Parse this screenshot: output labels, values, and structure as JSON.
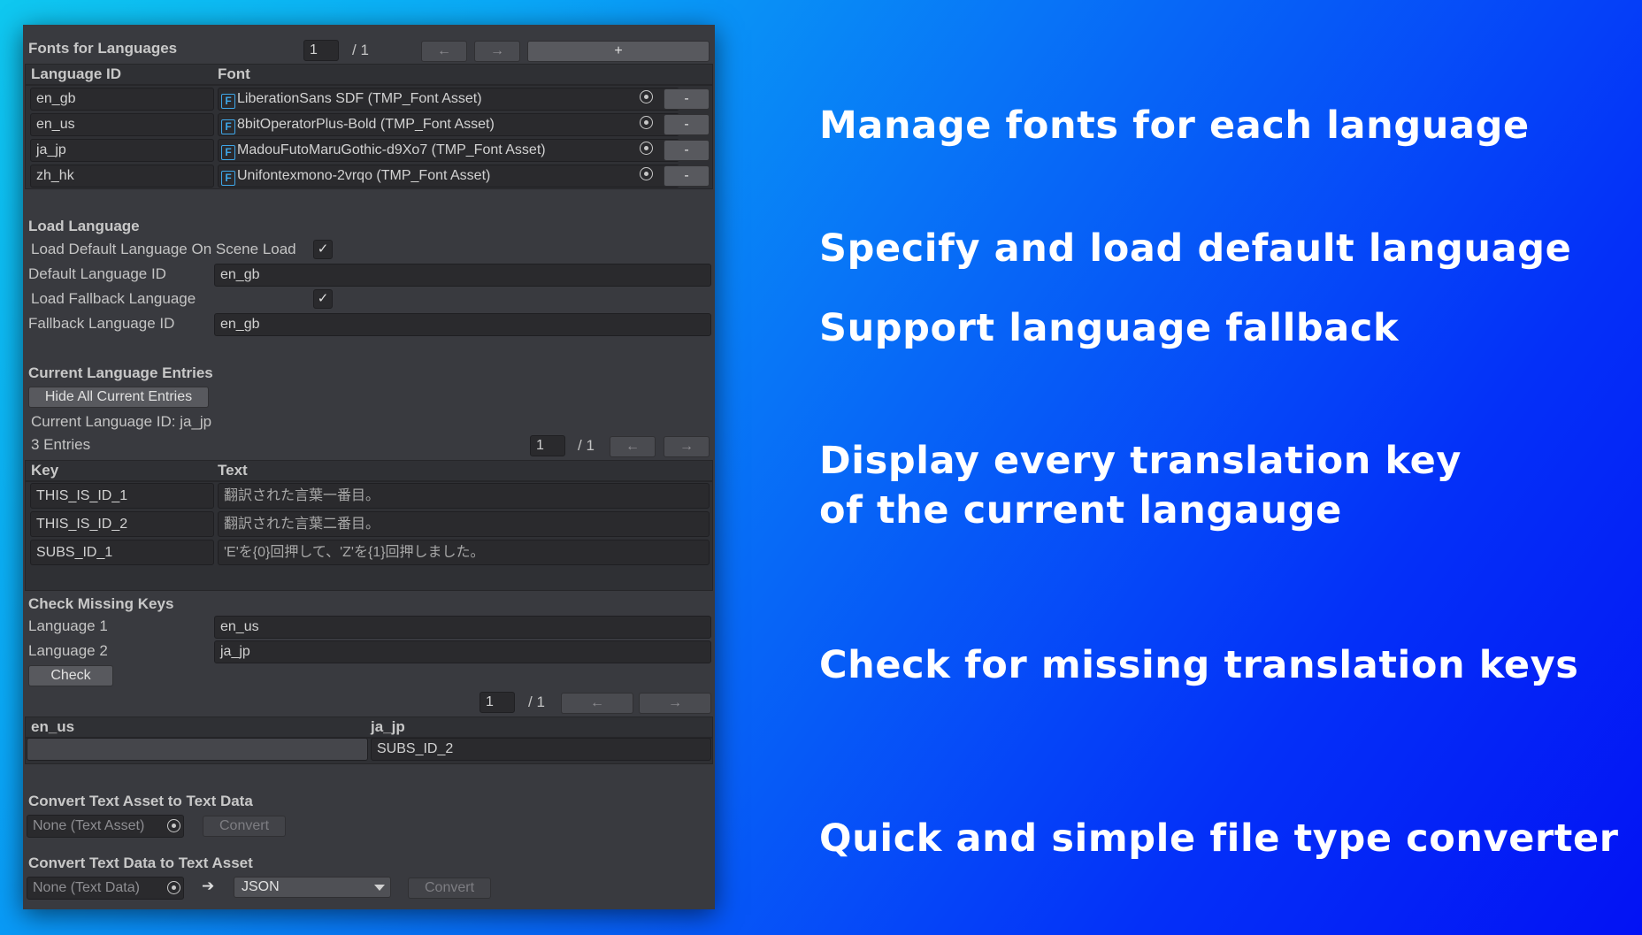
{
  "fonts_section": {
    "title": "Fonts for Languages",
    "page_value": "1",
    "page_total": "/ 1",
    "prev_icon": "←",
    "next_icon": "→",
    "add_label": "+",
    "col_language": "Language ID",
    "col_font": "Font",
    "remove_label": "-",
    "rows": [
      {
        "lang": "en_gb",
        "font": "LiberationSans SDF (TMP_Font Asset)"
      },
      {
        "lang": "en_us",
        "font": "8bitOperatorPlus-Bold (TMP_Font Asset)"
      },
      {
        "lang": "ja_jp",
        "font": "MadouFutoMaruGothic-d9Xo7 (TMP_Font Asset)"
      },
      {
        "lang": "zh_hk",
        "font": "Unifontexmono-2vrqo (TMP_Font Asset)"
      }
    ]
  },
  "load_section": {
    "title": "Load Language",
    "load_default_label": "Load Default Language On Scene Load",
    "load_default_checked": "✓",
    "default_id_label": "Default Language ID",
    "default_id_value": "en_gb",
    "load_fallback_label": "Load Fallback Language",
    "load_fallback_checked": "✓",
    "fallback_id_label": "Fallback Language ID",
    "fallback_id_value": "en_gb"
  },
  "entries_section": {
    "title": "Current Language Entries",
    "hide_button": "Hide All Current Entries",
    "current_id": "Current Language ID: ja_jp",
    "count": "3 Entries",
    "page_value": "1",
    "page_total": "/ 1",
    "prev_icon": "←",
    "next_icon": "→",
    "col_key": "Key",
    "col_text": "Text",
    "rows": [
      {
        "key": "THIS_IS_ID_1",
        "text": "翻訳された言葉一番目。"
      },
      {
        "key": "THIS_IS_ID_2",
        "text": "翻訳された言葉二番目。"
      },
      {
        "key": "SUBS_ID_1",
        "text": "'E'を{0}回押して、'Z'を{1}回押しました。"
      }
    ]
  },
  "missing_section": {
    "title": "Check Missing Keys",
    "lang1_label": "Language 1",
    "lang1_value": "en_us",
    "lang2_label": "Language 2",
    "lang2_value": "ja_jp",
    "check_button": "Check",
    "page_value": "1",
    "page_total": "/ 1",
    "prev_icon": "←",
    "next_icon": "→",
    "col_left": "en_us",
    "col_right": "ja_jp",
    "left_value": "",
    "right_value": "SUBS_ID_2"
  },
  "convert_section": {
    "title_asset_to_data": "Convert Text Asset to Text Data",
    "asset_placeholder": "None (Text Asset)",
    "convert_label": "Convert",
    "title_data_to_asset": "Convert Text Data to Text Asset",
    "data_placeholder": "None (Text Data)",
    "arrow": "➔",
    "format_value": "JSON",
    "convert_label_2": "Convert"
  },
  "captions": [
    "Manage fonts for each language",
    "Specify and load default language",
    "Support language fallback",
    "Display every translation key",
    "of the current langauge",
    "Check for missing translation keys",
    "Quick and simple file type converter"
  ],
  "icons": {
    "font_asset": "F",
    "object_picker": "target-icon",
    "dropdown": "chevron-down-icon"
  },
  "colors": {
    "panel_bg": "#393a3f",
    "field_bg": "#2a2a2d",
    "font_icon": "#3ea6e8",
    "caption_text": "#ffffff"
  }
}
